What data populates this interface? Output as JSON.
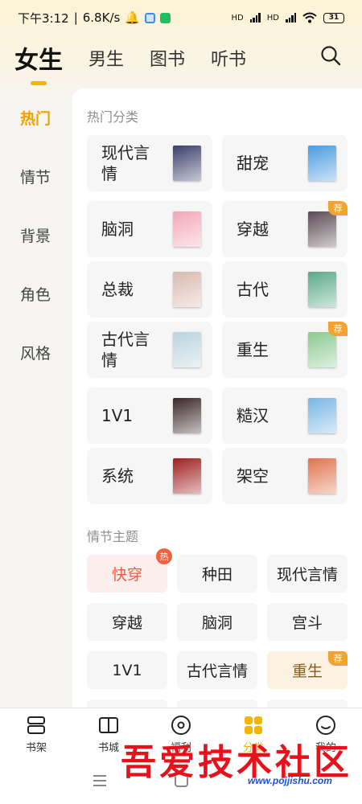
{
  "status_bar": {
    "time": "下午3:12",
    "speed": "6.8K/s",
    "net1": "HD",
    "net2": "HD",
    "battery": "31"
  },
  "top_tabs": [
    "女生",
    "男生",
    "图书",
    "听书"
  ],
  "sidebar": [
    "热门",
    "情节",
    "背景",
    "角色",
    "风格"
  ],
  "hot_section": {
    "title": "热门分类",
    "items": [
      {
        "label": "现代言情",
        "badge": "",
        "cover": "#3a3f6a"
      },
      {
        "label": "甜宠",
        "badge": "",
        "cover": "#4a9be0"
      },
      {
        "label": "脑洞",
        "badge": "",
        "cover": "#f3a6b8"
      },
      {
        "label": "穿越",
        "badge": "荐",
        "cover": "#5b4a52"
      },
      {
        "label": "总裁",
        "badge": "",
        "cover": "#d9b9b0"
      },
      {
        "label": "古代",
        "badge": "",
        "cover": "#5aa88a"
      },
      {
        "label": "古代言情",
        "badge": "",
        "cover": "#b9d3de"
      },
      {
        "label": "重生",
        "badge": "荐",
        "cover": "#8bc98f"
      },
      {
        "label": "1V1",
        "badge": "",
        "cover": "#3a2628"
      },
      {
        "label": "糙汉",
        "badge": "",
        "cover": "#79b6e3"
      },
      {
        "label": "系统",
        "badge": "",
        "cover": "#a01e1e"
      },
      {
        "label": "架空",
        "badge": "",
        "cover": "#e0744e"
      }
    ]
  },
  "theme_section": {
    "title": "情节主题",
    "items": [
      {
        "label": "快穿",
        "tag": "热",
        "style": "hot"
      },
      {
        "label": "种田",
        "tag": "",
        "style": ""
      },
      {
        "label": "现代言情",
        "tag": "",
        "style": ""
      },
      {
        "label": "穿越",
        "tag": "",
        "style": ""
      },
      {
        "label": "脑洞",
        "tag": "",
        "style": ""
      },
      {
        "label": "宫斗",
        "tag": "",
        "style": ""
      },
      {
        "label": "1V1",
        "tag": "",
        "style": ""
      },
      {
        "label": "古代言情",
        "tag": "",
        "style": ""
      },
      {
        "label": "重生",
        "tag": "荐",
        "style": "rec"
      }
    ]
  },
  "bottom_nav": [
    "书架",
    "书城",
    "福利",
    "分类",
    "我的"
  ],
  "watermark": {
    "text": "吾爱技术社区",
    "url": "www.pojjishu.com"
  },
  "colors": {
    "accent": "#f0b000",
    "hot": "#f05a4a",
    "badge": "#f3a234"
  }
}
